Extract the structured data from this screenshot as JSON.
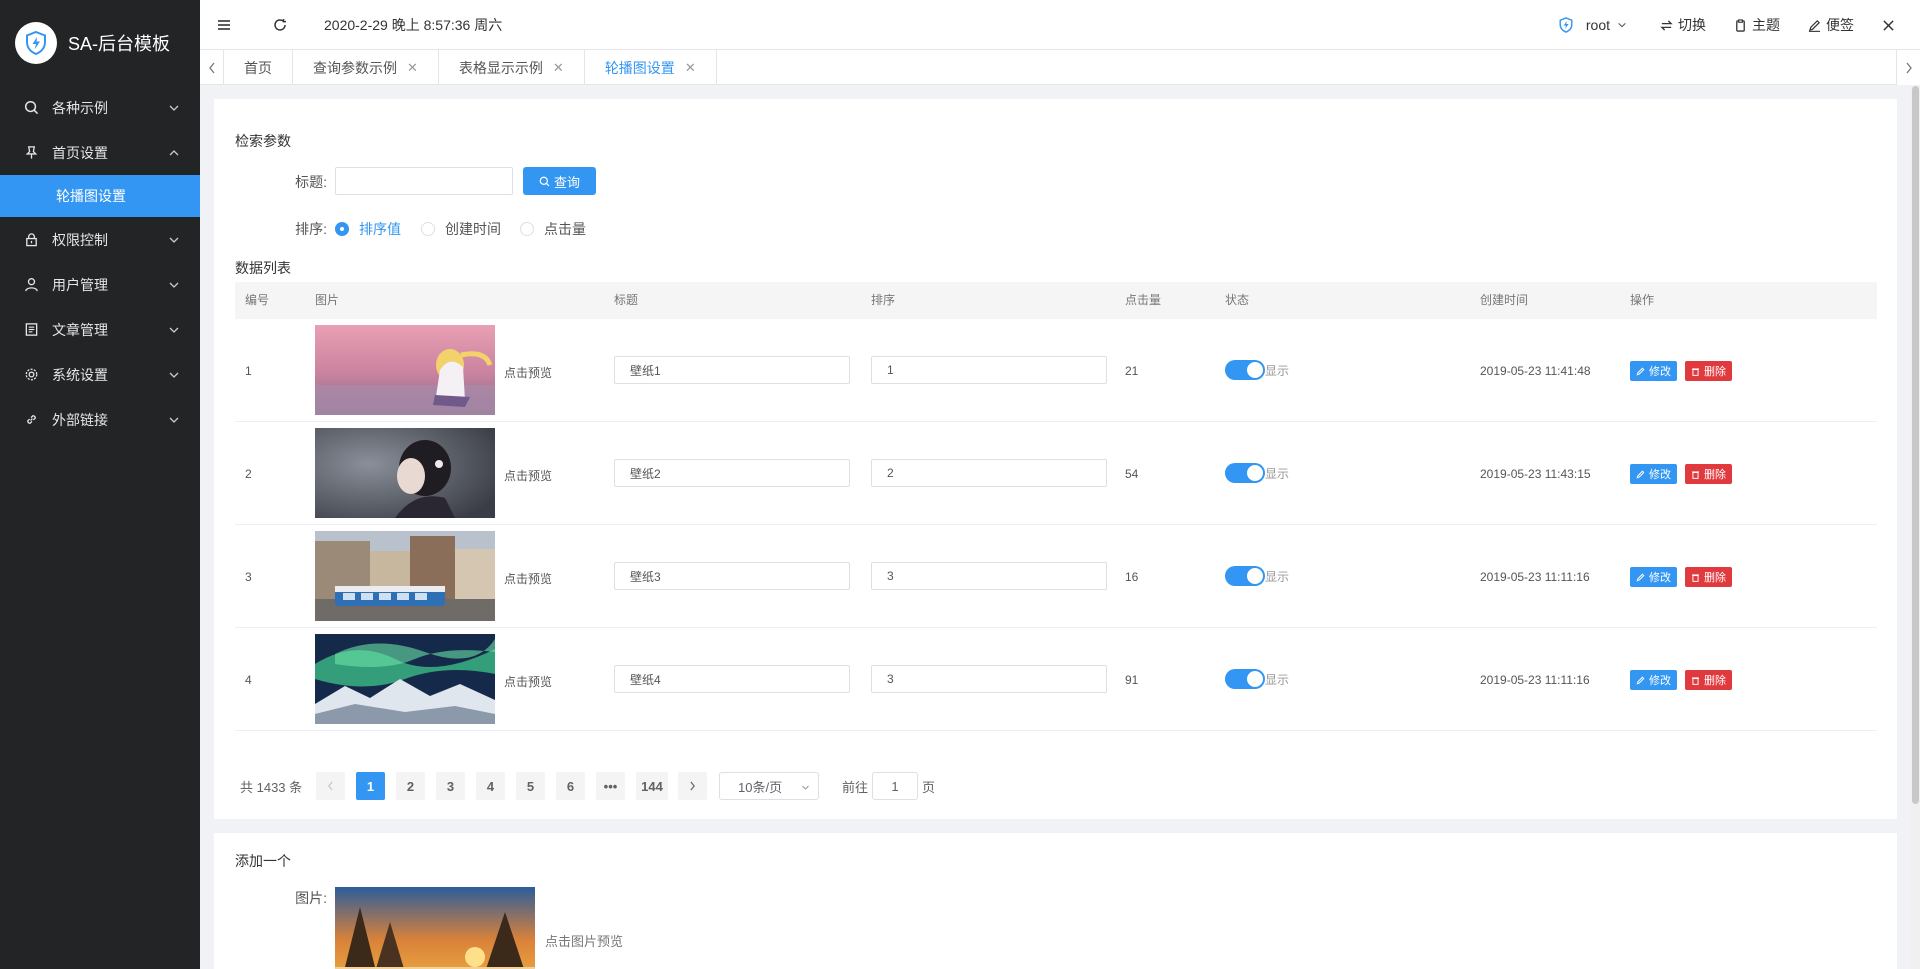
{
  "app": {
    "title": "SA-后台模板"
  },
  "sidebar": {
    "items": [
      {
        "label": "各种示例",
        "icon": "search-icon",
        "expanded": false
      },
      {
        "label": "首页设置",
        "icon": "pin-icon",
        "expanded": true,
        "children": [
          {
            "label": "轮播图设置",
            "active": true
          }
        ]
      },
      {
        "label": "权限控制",
        "icon": "lock-icon",
        "expanded": false
      },
      {
        "label": "用户管理",
        "icon": "user-icon",
        "expanded": false
      },
      {
        "label": "文章管理",
        "icon": "document-icon",
        "expanded": false
      },
      {
        "label": "系统设置",
        "icon": "gear-icon",
        "expanded": false
      },
      {
        "label": "外部链接",
        "icon": "link-icon",
        "expanded": false
      }
    ]
  },
  "header": {
    "time": "2020-2-29 晚上 8:57:36 周六",
    "user": "root",
    "switch_label": "切换",
    "theme_label": "主题",
    "note_label": "便签"
  },
  "tabs": [
    {
      "label": "首页",
      "closable": false,
      "active": false
    },
    {
      "label": "查询参数示例",
      "closable": true,
      "active": false
    },
    {
      "label": "表格显示示例",
      "closable": true,
      "active": false
    },
    {
      "label": "轮播图设置",
      "closable": true,
      "active": true
    }
  ],
  "search": {
    "section_title": "检索参数",
    "title_label": "标题:",
    "title_value": "",
    "query_button": "查询",
    "sort_label": "排序:",
    "sort_options": [
      "排序值",
      "创建时间",
      "点击量"
    ],
    "sort_selected": "排序值"
  },
  "table": {
    "section_title": "数据列表",
    "columns": [
      "编号",
      "图片",
      "标题",
      "排序",
      "点击量",
      "状态",
      "创建时间",
      "操作"
    ],
    "preview_text": "点击预览",
    "status_text": "显示",
    "edit_label": "修改",
    "delete_label": "删除",
    "rows": [
      {
        "id": "1",
        "title": "壁纸1",
        "sort": "1",
        "clicks": "21",
        "status_on": true,
        "created": "2019-05-23 11:41:48",
        "image": "anime-girl-pink-sky"
      },
      {
        "id": "2",
        "title": "壁纸2",
        "sort": "2",
        "clicks": "54",
        "status_on": true,
        "created": "2019-05-23 11:43:15",
        "image": "anime-girl-dark-portrait"
      },
      {
        "id": "3",
        "title": "壁纸3",
        "sort": "3",
        "clicks": "16",
        "status_on": true,
        "created": "2019-05-23 11:11:16",
        "image": "city-tram-street"
      },
      {
        "id": "4",
        "title": "壁纸4",
        "sort": "3",
        "clicks": "91",
        "status_on": true,
        "created": "2019-05-23 11:11:16",
        "image": "aurora-mountains"
      }
    ]
  },
  "pagination": {
    "total_text": "共 1433 条",
    "pages": [
      "1",
      "2",
      "3",
      "4",
      "5",
      "6",
      "•••",
      "144"
    ],
    "current": "1",
    "page_size": "10条/页",
    "goto_prefix": "前往",
    "goto_value": "1",
    "goto_suffix": "页"
  },
  "add_form": {
    "section_title": "添加一个",
    "image_label": "图片:",
    "preview_hint": "点击图片预览",
    "image": "sunset-forest"
  },
  "colors": {
    "accent": "#3396f2",
    "danger": "#e0393e",
    "sidebar_bg": "#222426"
  }
}
